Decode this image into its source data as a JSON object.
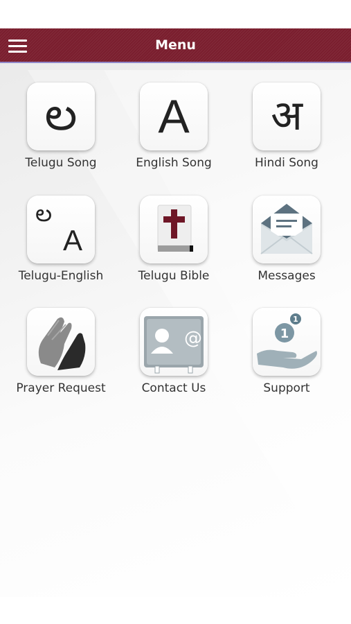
{
  "header": {
    "title": "Menu",
    "bar_color": "#7a1e2e"
  },
  "menu": {
    "items": [
      {
        "label": "Telugu Song",
        "icon": "telugu-letter-icon",
        "glyph": "ల"
      },
      {
        "label": "English Song",
        "icon": "letter-a-icon",
        "glyph": "A"
      },
      {
        "label": "Hindi Song",
        "icon": "hindi-letter-icon",
        "glyph": "अ"
      },
      {
        "label": "Telugu-English",
        "icon": "telugu-english-icon",
        "glyph": "ల",
        "glyph2": "A"
      },
      {
        "label": "Telugu Bible",
        "icon": "bible-icon"
      },
      {
        "label": "Messages",
        "icon": "envelope-icon"
      },
      {
        "label": "Prayer Request",
        "icon": "praying-hands-icon"
      },
      {
        "label": "Contact Us",
        "icon": "contact-card-icon"
      },
      {
        "label": "Support",
        "icon": "donation-hand-icon",
        "badge": "1",
        "coin": "1"
      }
    ]
  }
}
